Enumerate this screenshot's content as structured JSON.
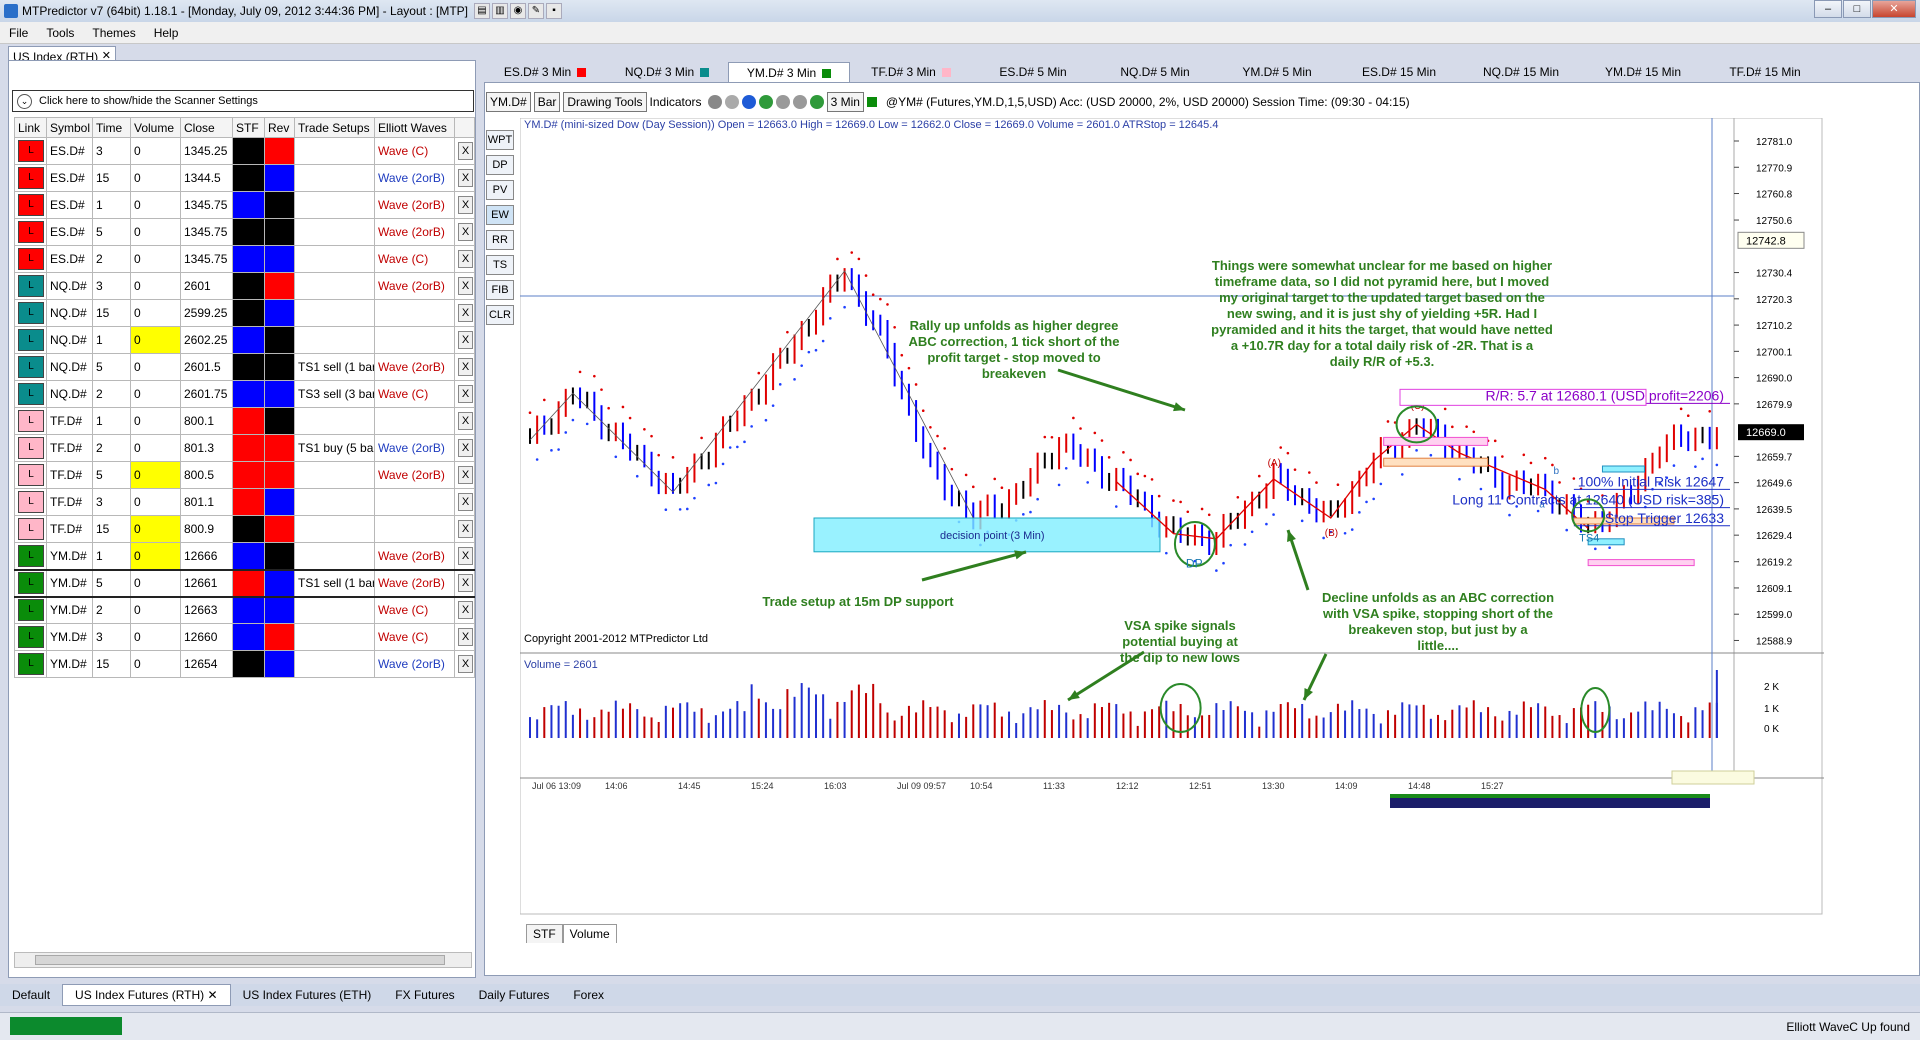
{
  "window": {
    "title": "MTPredictor v7 (64bit) 1.18.1 - [Monday, July 09, 2012 3:44:36 PM]  - Layout : [MTP]"
  },
  "menu": [
    "File",
    "Tools",
    "Themes",
    "Help"
  ],
  "left_panel": {
    "tab_label": "US Index (RTH)",
    "scanner_toggle": "Click here to show/hide the Scanner Settings",
    "columns": [
      "Link",
      "Symbol",
      "Time",
      "Volume",
      "Close",
      "STF",
      "Rev",
      "Trade Setups",
      "Elliott Waves"
    ],
    "rows": [
      {
        "link": "L",
        "link_color": "#ff0000",
        "symbol": "ES.D#",
        "time": "3",
        "volume": "0",
        "vol_yellow": false,
        "close": "1345.25",
        "stf": "#000000",
        "rev": "#ff0000",
        "setup": "",
        "wave": "Wave (C)",
        "wave_blue": false
      },
      {
        "link": "L",
        "link_color": "#ff0000",
        "symbol": "ES.D#",
        "time": "15",
        "volume": "0",
        "vol_yellow": false,
        "close": "1344.5",
        "stf": "#000000",
        "rev": "#0000ff",
        "setup": "",
        "wave": "Wave (2orB)",
        "wave_blue": true
      },
      {
        "link": "L",
        "link_color": "#ff0000",
        "symbol": "ES.D#",
        "time": "1",
        "volume": "0",
        "vol_yellow": false,
        "close": "1345.75",
        "stf": "#0000ff",
        "rev": "#000000",
        "setup": "",
        "wave": "Wave (2orB)",
        "wave_blue": false
      },
      {
        "link": "L",
        "link_color": "#ff0000",
        "symbol": "ES.D#",
        "time": "5",
        "volume": "0",
        "vol_yellow": false,
        "close": "1345.75",
        "stf": "#000000",
        "rev": "#000000",
        "setup": "",
        "wave": "Wave (2orB)",
        "wave_blue": false
      },
      {
        "link": "L",
        "link_color": "#ff0000",
        "symbol": "ES.D#",
        "time": "2",
        "volume": "0",
        "vol_yellow": false,
        "close": "1345.75",
        "stf": "#0000ff",
        "rev": "#0000ff",
        "setup": "",
        "wave": "Wave (C)",
        "wave_blue": false
      },
      {
        "link": "L",
        "link_color": "#0a8c8c",
        "symbol": "NQ.D#",
        "time": "3",
        "volume": "0",
        "vol_yellow": false,
        "close": "2601",
        "stf": "#000000",
        "rev": "#ff0000",
        "setup": "",
        "wave": "Wave (2orB)",
        "wave_blue": false
      },
      {
        "link": "L",
        "link_color": "#0a8c8c",
        "symbol": "NQ.D#",
        "time": "15",
        "volume": "0",
        "vol_yellow": false,
        "close": "2599.25",
        "stf": "#000000",
        "rev": "#0000ff",
        "setup": "",
        "wave": "",
        "wave_blue": false
      },
      {
        "link": "L",
        "link_color": "#0a8c8c",
        "symbol": "NQ.D#",
        "time": "1",
        "volume": "0",
        "vol_yellow": true,
        "close": "2602.25",
        "stf": "#0000ff",
        "rev": "#000000",
        "setup": "",
        "wave": "",
        "wave_blue": false
      },
      {
        "link": "L",
        "link_color": "#0a8c8c",
        "symbol": "NQ.D#",
        "time": "5",
        "volume": "0",
        "vol_yellow": false,
        "close": "2601.5",
        "stf": "#000000",
        "rev": "#000000",
        "setup": "TS1 sell (1 bar",
        "wave": "Wave (2orB)",
        "wave_blue": false
      },
      {
        "link": "L",
        "link_color": "#0a8c8c",
        "symbol": "NQ.D#",
        "time": "2",
        "volume": "0",
        "vol_yellow": false,
        "close": "2601.75",
        "stf": "#0000ff",
        "rev": "#0000ff",
        "setup": "TS3 sell (3 bar",
        "wave": "Wave (C)",
        "wave_blue": false
      },
      {
        "link": "L",
        "link_color": "#ffb6c8",
        "symbol": "TF.D#",
        "time": "1",
        "volume": "0",
        "vol_yellow": false,
        "close": "800.1",
        "stf": "#ff0000",
        "rev": "#000000",
        "setup": "",
        "wave": "",
        "wave_blue": false
      },
      {
        "link": "L",
        "link_color": "#ffb6c8",
        "symbol": "TF.D#",
        "time": "2",
        "volume": "0",
        "vol_yellow": false,
        "close": "801.3",
        "stf": "#ff0000",
        "rev": "#ff0000",
        "setup": "TS1 buy (5 bar",
        "wave": "Wave (2orB)",
        "wave_blue": true
      },
      {
        "link": "L",
        "link_color": "#ffb6c8",
        "symbol": "TF.D#",
        "time": "5",
        "volume": "0",
        "vol_yellow": true,
        "close": "800.5",
        "stf": "#ff0000",
        "rev": "#ff0000",
        "setup": "",
        "wave": "Wave (2orB)",
        "wave_blue": false
      },
      {
        "link": "L",
        "link_color": "#ffb6c8",
        "symbol": "TF.D#",
        "time": "3",
        "volume": "0",
        "vol_yellow": false,
        "close": "801.1",
        "stf": "#ff0000",
        "rev": "#0000ff",
        "setup": "",
        "wave": "",
        "wave_blue": false
      },
      {
        "link": "L",
        "link_color": "#ffb6c8",
        "symbol": "TF.D#",
        "time": "15",
        "volume": "0",
        "vol_yellow": true,
        "close": "800.9",
        "stf": "#000000",
        "rev": "#ff0000",
        "setup": "",
        "wave": "",
        "wave_blue": false
      },
      {
        "link": "L",
        "link_color": "#0a8c0a",
        "symbol": "YM.D#",
        "time": "1",
        "volume": "0",
        "vol_yellow": true,
        "close": "12666",
        "stf": "#0000ff",
        "rev": "#000000",
        "setup": "",
        "wave": "Wave (2orB)",
        "wave_blue": false
      },
      {
        "link": "L",
        "link_color": "#0a8c0a",
        "symbol": "YM.D#",
        "time": "5",
        "volume": "0",
        "vol_yellow": false,
        "close": "12661",
        "stf": "#ff0000",
        "rev": "#0000ff",
        "setup": "TS1 sell (1 bar",
        "wave": "Wave (2orB)",
        "wave_blue": false,
        "selected": true
      },
      {
        "link": "L",
        "link_color": "#0a8c0a",
        "symbol": "YM.D#",
        "time": "2",
        "volume": "0",
        "vol_yellow": false,
        "close": "12663",
        "stf": "#0000ff",
        "rev": "#0000ff",
        "setup": "",
        "wave": "Wave (C)",
        "wave_blue": false
      },
      {
        "link": "L",
        "link_color": "#0a8c0a",
        "symbol": "YM.D#",
        "time": "3",
        "volume": "0",
        "vol_yellow": false,
        "close": "12660",
        "stf": "#0000ff",
        "rev": "#ff0000",
        "setup": "",
        "wave": "Wave (C)",
        "wave_blue": false
      },
      {
        "link": "L",
        "link_color": "#0a8c0a",
        "symbol": "YM.D#",
        "time": "15",
        "volume": "0",
        "vol_yellow": false,
        "close": "12654",
        "stf": "#000000",
        "rev": "#0000ff",
        "setup": "",
        "wave": "Wave (2orB)",
        "wave_blue": true
      }
    ]
  },
  "chart_tabs": [
    {
      "label": "ES.D# 3 Min",
      "swatch": "#ff0000",
      "active": false
    },
    {
      "label": "NQ.D# 3 Min",
      "swatch": "#0a8c8c",
      "active": false
    },
    {
      "label": "YM.D# 3 Min",
      "swatch": "#0a8c0a",
      "active": true
    },
    {
      "label": "TF.D# 3 Min",
      "swatch": "#ffb6c8",
      "active": false
    },
    {
      "label": "ES.D# 5 Min",
      "swatch": "",
      "active": false
    },
    {
      "label": "NQ.D# 5 Min",
      "swatch": "",
      "active": false
    },
    {
      "label": "YM.D# 5 Min",
      "swatch": "",
      "active": false
    },
    {
      "label": "ES.D# 15 Min",
      "swatch": "",
      "active": false
    },
    {
      "label": "NQ.D# 15 Min",
      "swatch": "",
      "active": false
    },
    {
      "label": "YM.D# 15 Min",
      "swatch": "",
      "active": false
    },
    {
      "label": "TF.D# 15 Min",
      "swatch": "",
      "active": false
    }
  ],
  "toolbar": {
    "symbol_btn": "YM.D#",
    "bar_btn": "Bar",
    "drawing_tools": "Drawing Tools",
    "indicators": "Indicators",
    "interval_btn": "3 Min",
    "info": "@YM# (Futures,YM.D,1,5,USD) Acc: (USD 20000, 2%, USD 20000) Session Time: (09:30 - 04:15)"
  },
  "side_tools": [
    "WPT",
    "DP",
    "PV",
    "EW",
    "RR",
    "TS",
    "FIB",
    "CLR"
  ],
  "chart": {
    "header": "YM.D# (mini-sized Dow (Day Session)) Open = 12663.0  High = 12669.0  Low = 12662.0  Close = 12669.0  Volume = 2601.0  ATRStop = 12645.4",
    "copyright": "Copyright 2001-2012 MTPredictor Ltd",
    "volume_label": "Volume = 2601",
    "price_ticks": [
      "12781.0",
      "12770.9",
      "12760.8",
      "12750.6",
      "12730.4",
      "12720.3",
      "12710.2",
      "12700.1",
      "12690.0",
      "12679.9",
      "12659.7",
      "12649.6",
      "12639.5",
      "12629.4",
      "12619.2",
      "12609.1",
      "12599.0",
      "12588.9"
    ],
    "price_marker_top": "12742.8",
    "price_marker_current": "12669.0",
    "volume_ticks": [
      "2 K",
      "1 K",
      "0 K"
    ],
    "time_ticks": [
      "Jul 06 13:09",
      "14:06",
      "14:45",
      "15:24",
      "16:03",
      "Jul 09 09:57",
      "10:54",
      "11:33",
      "12:12",
      "12:51",
      "13:30",
      "14:09",
      "14:48",
      "15:27"
    ],
    "wave_labels": [
      "(A)",
      "(B)",
      "(C)",
      "a",
      "b"
    ],
    "annotations": {
      "rally": "Rally up unfolds as higher degree ABC correction, 1 tick short of the profit target - stop moved to breakeven",
      "unclear": "Things were somewhat unclear for me based on higher timeframe data, so I did not pyramid here, but I moved my original target to the updated target based on the new swing, and it is just shy of yielding +5R. Had I pyramided and it hits the target, that would have netted a +10.7R day for a total daily risk of -2R. That is a daily R/R of +5.3.",
      "trade_setup": "Trade setup at 15m DP support",
      "vsa": "VSA spike signals potential buying at the dip to new lows",
      "decline": "Decline unfolds as an ABC correction with VSA spike, stopping short of the breakeven stop, but just by a little....",
      "decision_point": "decision point (3 Min)",
      "dp": "DP",
      "ts4": "TS4"
    },
    "trade_levels": {
      "rr": "R/R: 5.7 at 12680.1 (USD profit=2206)",
      "initial_risk": "100% Initial Risk 12647",
      "long": "Long 11 Contracts at 12640 (USD risk=385)",
      "stop": "Stop Trigger 12633"
    }
  },
  "bottom_tabs": [
    "STF",
    "Volume"
  ],
  "layout_tabs": [
    {
      "label": "Default",
      "active": false
    },
    {
      "label": "US Index Futures (RTH)",
      "active": true
    },
    {
      "label": "US Index Futures (ETH)",
      "active": false
    },
    {
      "label": "FX Futures",
      "active": false
    },
    {
      "label": "Daily Futures",
      "active": false
    },
    {
      "label": "Forex",
      "active": false
    }
  ],
  "status": {
    "right_text": "Elliott WaveC Up found"
  },
  "colors": {
    "annotation_green": "#2f7f1f",
    "up_bar": "#e00000",
    "down_bar": "#0000ff",
    "neutral_bar": "#000000"
  }
}
